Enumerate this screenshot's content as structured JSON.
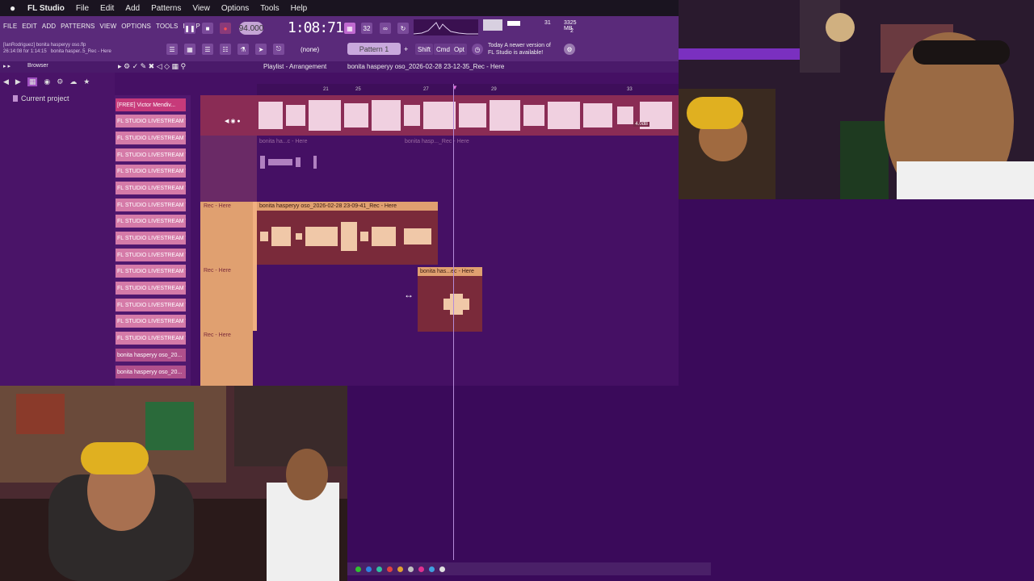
{
  "mac_menu": {
    "app": "FL Studio",
    "items": [
      "File",
      "Edit",
      "Add",
      "Patterns",
      "View",
      "Options",
      "Tools",
      "Help"
    ]
  },
  "fl_menu": [
    "FILE",
    "EDIT",
    "ADD",
    "PATTERNS",
    "VIEW",
    "OPTIONS",
    "TOOLS",
    "HELP"
  ],
  "hint": {
    "line1": "[IanRodriguez] bonita hasperyy oso.flp",
    "line2": "26:14:08 for 1:14:15",
    "line3": "bonita hasper..5_Rec - Here"
  },
  "transport": {
    "bpm": "94.000",
    "time": "1:08:71",
    "cpu_value": "31",
    "memory": "3325 MB",
    "voices": "2"
  },
  "pattern": {
    "label": "Pattern 1",
    "none_label": "(none)"
  },
  "buttons": {
    "shift": "Shift",
    "cmd": "Cmd",
    "opt": "Opt"
  },
  "news": {
    "line1": "Today  A newer version of",
    "line2": "FL Studio is available!"
  },
  "browser": {
    "title": "Browser",
    "current_project": "Current project"
  },
  "playlist": {
    "title": "Playlist - Arrangement",
    "breadcrumb": "bonita hasperyy oso_2026-02-28 23-12-35_Rec - Here",
    "ruler": [
      "21",
      "25",
      "27",
      "29",
      "33"
    ],
    "db_label": "4.0dB"
  },
  "tracks": [
    "[FREE] Victor Mendiv...",
    "FL STUDIO LIVESTREAM T...",
    "FL STUDIO LIVESTREAM T...",
    "FL STUDIO LIVESTREAM T...",
    "FL STUDIO LIVESTREAM T...",
    "FL STUDIO LIVESTREAM T...",
    "FL STUDIO LIVESTREAM T...",
    "FL STUDIO LIVESTREAM T...",
    "FL STUDIO LIVESTREAM T...",
    "FL STUDIO LIVESTREAM T...",
    "FL STUDIO LIVESTREAM T...",
    "FL STUDIO LIVESTREAM T...",
    "FL STUDIO LIVESTREAM T...",
    "FL STUDIO LIVESTREAM T...",
    "FL STUDIO LIVESTREAM T...",
    "bonita hasperyy oso_20...",
    "bonita hasperyy oso_20..."
  ],
  "lanes": {
    "rec_here": "Rec - Here",
    "faded_clip1": "bonita ha...c - Here",
    "faded_clip2": "bonita hasp..._Rec - Here",
    "clip_main": "bonita hasperyy oso_2026-02-28 23-09-41_Rec - Here",
    "clip_small": "bonita has...ec - Here"
  },
  "colors": {
    "accent": "#5a2a7a",
    "track": "#d57aa8",
    "clip_orange": "#e0a070"
  }
}
